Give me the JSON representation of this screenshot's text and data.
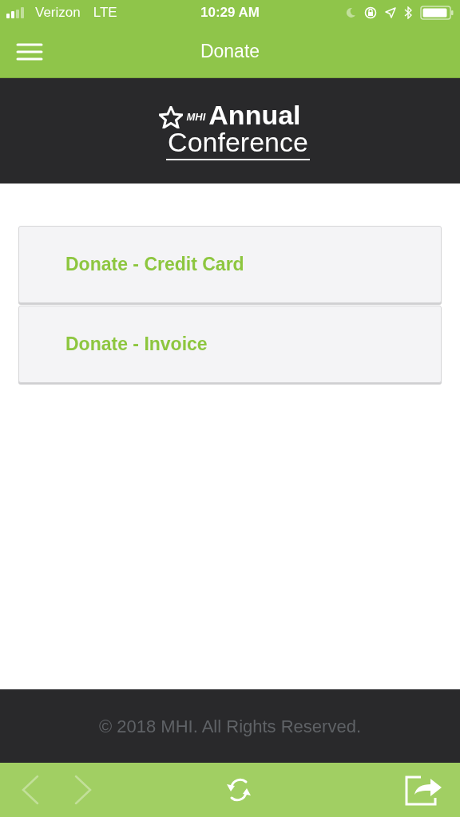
{
  "status_bar": {
    "carrier": "Verizon",
    "network": "LTE",
    "time": "10:29 AM"
  },
  "nav_bar": {
    "title": "Donate"
  },
  "banner": {
    "brand": "MHI",
    "line_1": "Annual",
    "line_2": "Conference"
  },
  "options": [
    {
      "label": "Donate - Credit Card"
    },
    {
      "label": "Donate - Invoice"
    }
  ],
  "footer": {
    "text": "© 2018 MHI. All Rights Reserved."
  },
  "toolbar": {
    "back": {
      "disabled": true
    },
    "forward": {
      "disabled": true
    }
  }
}
